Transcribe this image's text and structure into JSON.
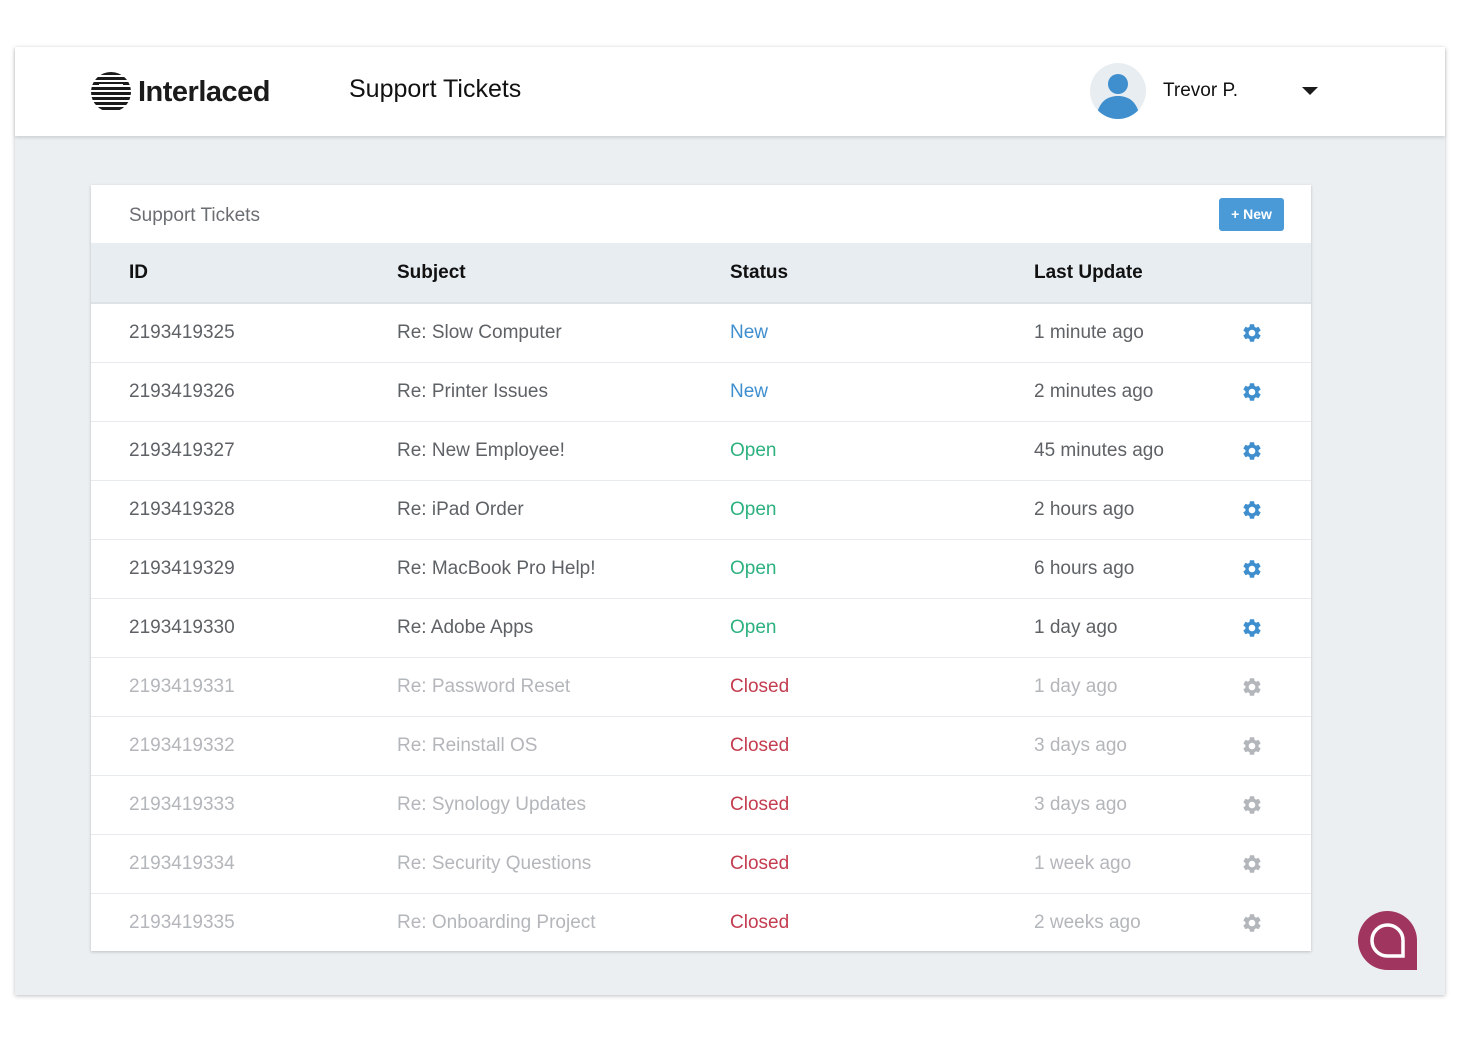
{
  "brand": {
    "name": "Interlaced"
  },
  "header": {
    "title": "Support Tickets"
  },
  "user": {
    "name": "Trevor P."
  },
  "panel": {
    "title": "Support Tickets",
    "new_button": "+ New"
  },
  "table": {
    "columns": [
      "ID",
      "Subject",
      "Status",
      "Last Update"
    ],
    "rows": [
      {
        "id": "2193419325",
        "subject": "Re: Slow Computer",
        "status": "New",
        "last_update": "1 minute ago"
      },
      {
        "id": "2193419326",
        "subject": "Re: Printer Issues",
        "status": "New",
        "last_update": "2 minutes ago"
      },
      {
        "id": "2193419327",
        "subject": "Re: New Employee!",
        "status": "Open",
        "last_update": "45 minutes ago"
      },
      {
        "id": "2193419328",
        "subject": "Re: iPad Order",
        "status": "Open",
        "last_update": "2 hours ago"
      },
      {
        "id": "2193419329",
        "subject": "Re: MacBook Pro Help!",
        "status": "Open",
        "last_update": "6 hours ago"
      },
      {
        "id": "2193419330",
        "subject": "Re: Adobe Apps",
        "status": "Open",
        "last_update": "1 day ago"
      },
      {
        "id": "2193419331",
        "subject": "Re: Password Reset",
        "status": "Closed",
        "last_update": "1 day ago"
      },
      {
        "id": "2193419332",
        "subject": "Re: Reinstall OS",
        "status": "Closed",
        "last_update": "3 days ago"
      },
      {
        "id": "2193419333",
        "subject": "Re: Synology Updates",
        "status": "Closed",
        "last_update": "3 days ago"
      },
      {
        "id": "2193419334",
        "subject": "Re: Security Questions",
        "status": "Closed",
        "last_update": "1 week ago"
      },
      {
        "id": "2193419335",
        "subject": "Re: Onboarding Project",
        "status": "Closed",
        "last_update": "2 weeks ago"
      }
    ]
  },
  "colors": {
    "status_new": "#3f8fcf",
    "status_open": "#2db17f",
    "status_closed": "#c43c4f",
    "gear_active": "#3f8fcf",
    "gear_inactive": "#b3b6ba",
    "accent_button": "#4a9ad8",
    "chat_widget": "#a0365f"
  },
  "icons": {
    "logo": "striped-globe-logo-icon",
    "avatar": "user-avatar-icon",
    "dropdown": "caret-down-icon",
    "row_action": "gear-icon",
    "chat": "chat-bubble-icon"
  }
}
